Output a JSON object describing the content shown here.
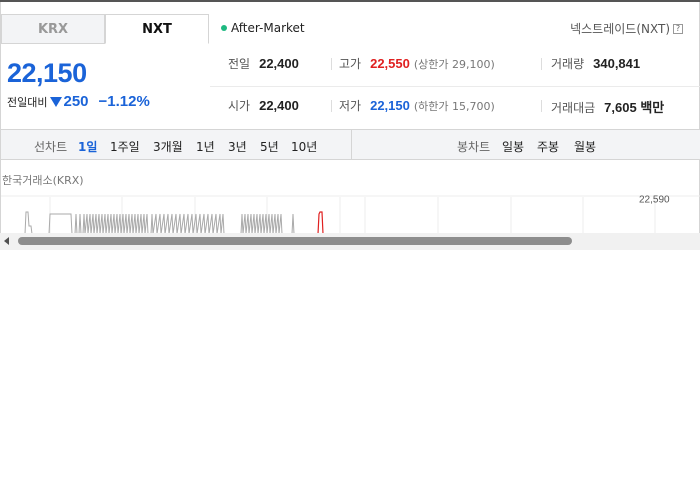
{
  "market_tabs": [
    {
      "label": "KRX",
      "active": false
    },
    {
      "label": "NXT",
      "active": true
    }
  ],
  "session": {
    "label": "After-Market",
    "dot_color": "#1eb980"
  },
  "exchange_note": {
    "label": "넥스트레이드(NXT)",
    "help_icon": "question-icon",
    "help_glyph": "?"
  },
  "price": {
    "current": "22,150",
    "change_label": "전일대비",
    "change_amount": "250",
    "change_direction": "down",
    "change_percent": "−1.12%",
    "color": "#1a63d8"
  },
  "stats": {
    "prev_close": {
      "label": "전일",
      "value": "22,400"
    },
    "high": {
      "label": "고가",
      "value": "22,550",
      "sub": "(상한가 29,100)"
    },
    "volume": {
      "label": "거래량",
      "value": "340,841"
    },
    "open": {
      "label": "시가",
      "value": "22,400"
    },
    "low": {
      "label": "저가",
      "value": "22,150",
      "sub": "(하한가 15,700)"
    },
    "amount": {
      "label": "거래대금",
      "value": "7,605 백만"
    }
  },
  "line_chart_tabs": {
    "label": "선차트",
    "items": [
      "1일",
      "1주일",
      "3개월",
      "1년",
      "3년",
      "5년",
      "10년"
    ],
    "active": "1일"
  },
  "candle_chart_tabs": {
    "label": "봉차트",
    "items": [
      "일봉",
      "주봉",
      "월봉"
    ]
  },
  "chart": {
    "title": "한국거래소(KRX)",
    "price_label": "22,590",
    "line_color": "#aaaaaa",
    "highlight_color": "#e02020"
  }
}
